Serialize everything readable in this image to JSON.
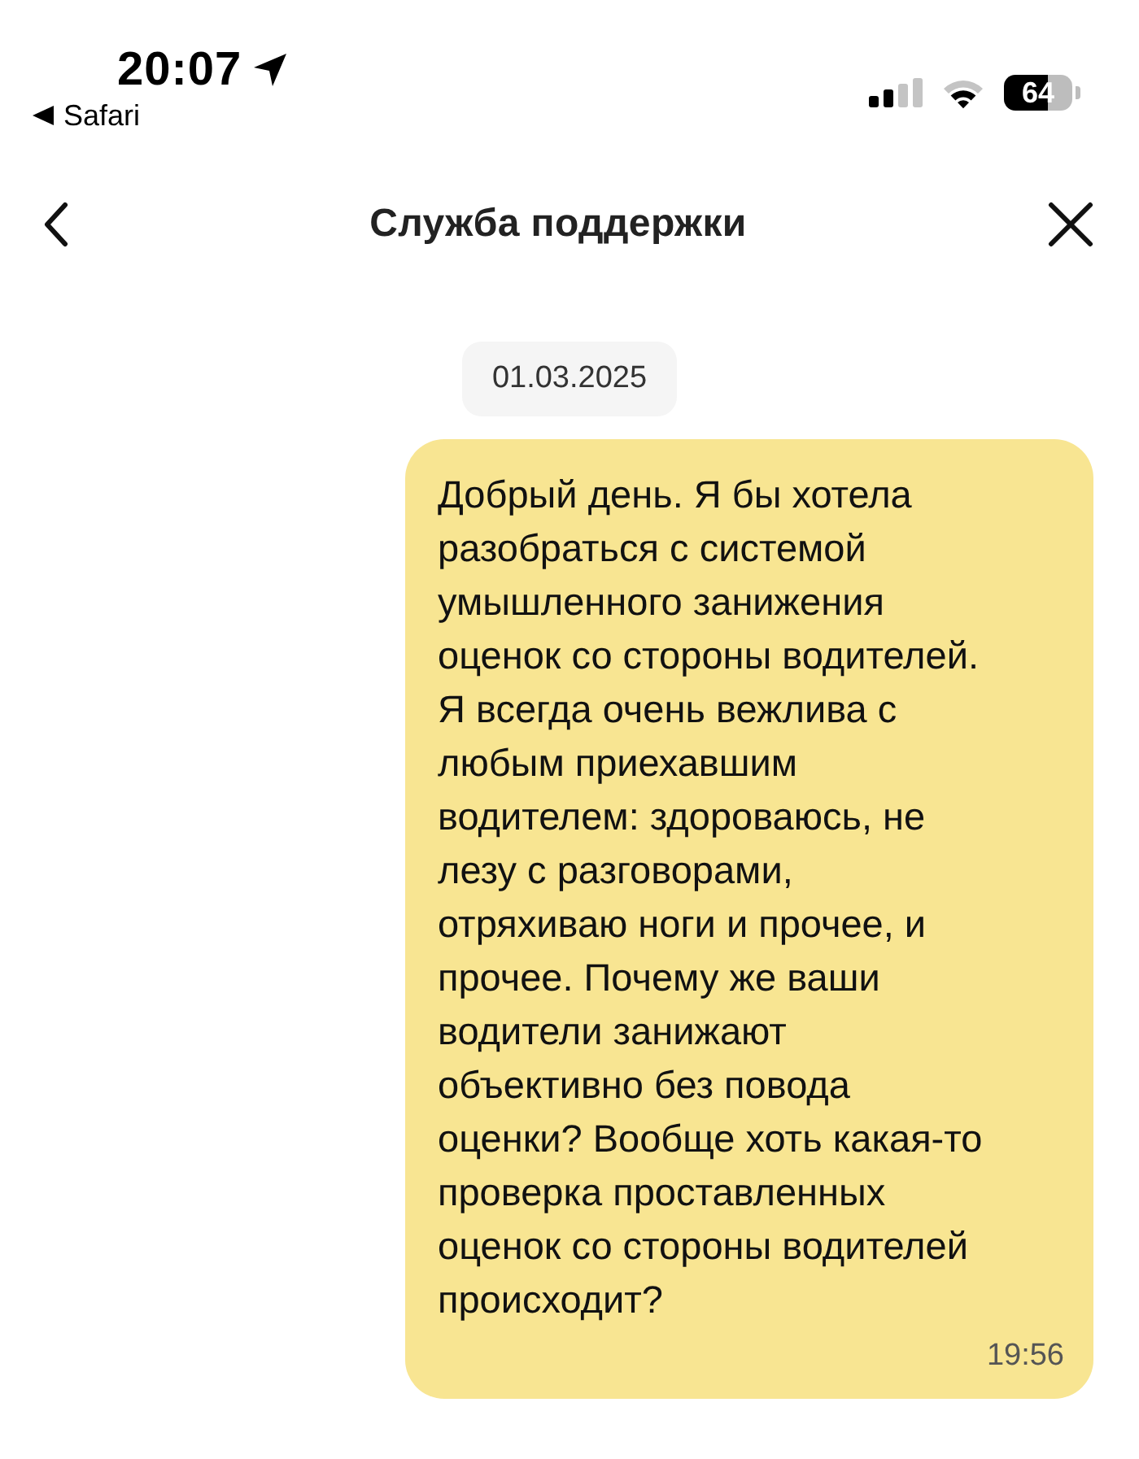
{
  "status_bar": {
    "time": "20:07",
    "back_app": "Safari",
    "battery": "64"
  },
  "header": {
    "title": "Служба поддержки"
  },
  "chat": {
    "date": "01.03.2025",
    "messages": [
      {
        "kind": "outgoing",
        "text": "Добрый день. Я бы хотела\nразобраться с системой\nумышленного занижения\nоценок со стороны водителей.\nЯ всегда очень вежлива с\nлюбым приехавшим\nводителем: здороваюсь, не\nлезу с разговорами,\nотряхиваю ноги и прочее, и\nпрочее. Почему же ваши\nводители занижают\nобъективно без повода\nоценки? Вообще хоть какая-то\nпроверка проставленных\nоценок со стороны водителей\nпроисходит?",
        "time": "19:56"
      }
    ]
  }
}
